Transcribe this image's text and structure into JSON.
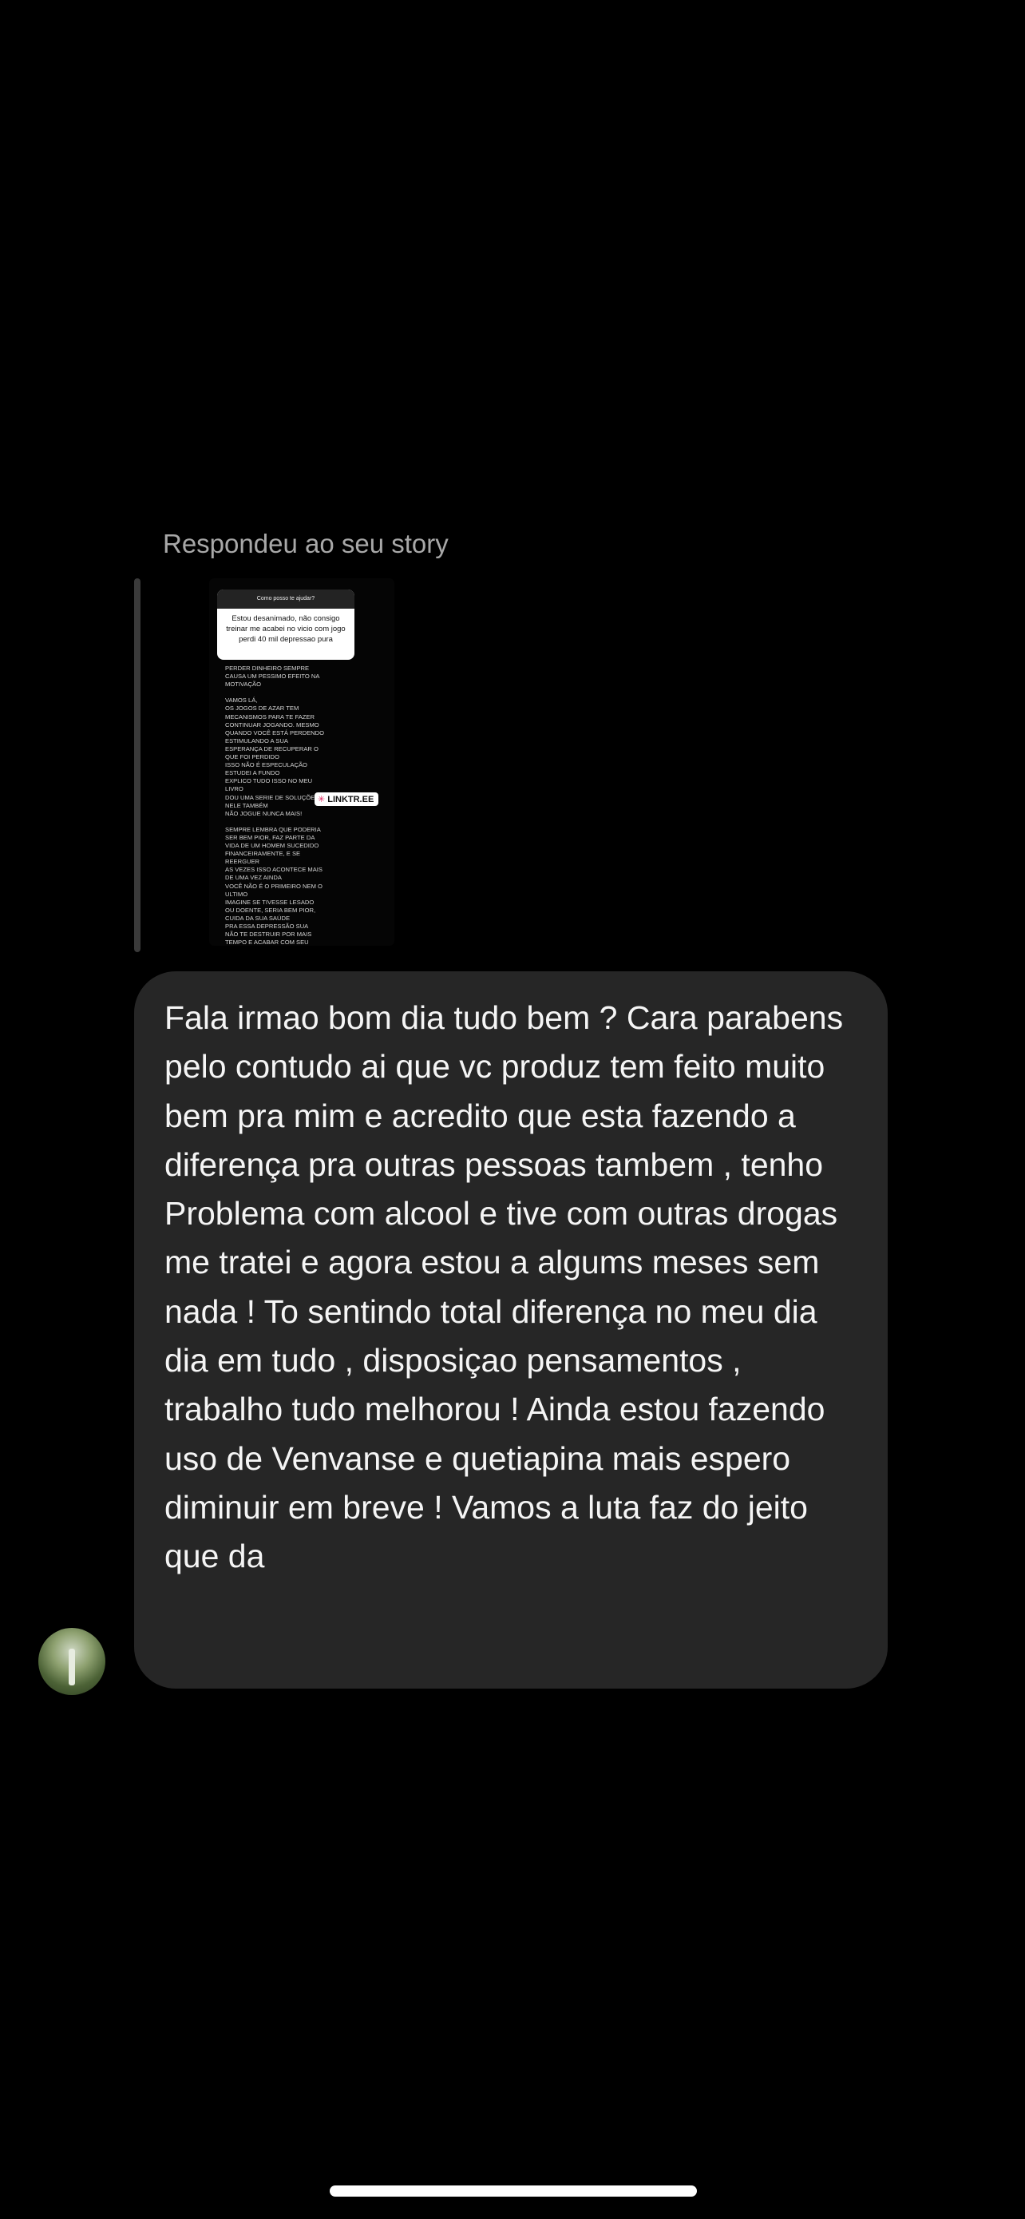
{
  "conversation": {
    "reply_context_label": "Respondeu ao seu story"
  },
  "story": {
    "question_header": "Como posso te ajudar?",
    "question_text": "Estou desanimado, não consigo treinar me acabei no vicio com jogo perdi 40 mil depressao pura",
    "body_text": "PERDER DINHEIRO SEMPRE\nCAUSA UM PESSIMO EFEITO NA\nMOTIVAÇÃO\n\nVAMOS LÁ,\nOS JOGOS DE AZAR TEM\nMECANISMOS PARA TE FAZER\nCONTINUAR JOGANDO. MESMO\nQUANDO VOCÊ ESTÁ PERDENDO\nESTIMULANDO A SUA\nESPERANÇA DE RECUPERAR O\nQUE FOI PERDIDO\nISSO NÃO É ESPECULAÇÃO\nESTUDEI A FUNDO\nEXPLICO TUDO ISSO NO MEU\nLIVRO\nDOU UMA SERIE DE SOLUÇÕES\nNELE TAMBÉM\nNÃO JOGUE NUNCA MAIS!\n\nSEMPRE LEMBRA QUE PODERIA\nSER BEM PIOR, FAZ PARTE DA\nVIDA DE UM HOMEM SUCEDIDO\nFINANCEIRAMENTE, E SE\nREERGUER\nAS VEZES ISSO ACONTECE MAIS\nDE UMA VEZ AINDA\nVOCÊ NÃO É O PRIMEIRO NEM O\nULTIMO\nIMAGINE SE TIVESSE LESADO\nOU DOENTE, SERIA BEM PIOR,\nCUIDA DA SUA SAÚDE\nPRA ESSA DEPRESSÃO SUA\nNÃO TE DESTRUIR POR MAIS\nTEMPO E ACABAR COM SEU\nBEM MAIS PRECIOSO\nSUA SAÚDE",
    "sticker_label": "LINKTR.EE"
  },
  "message": {
    "text": "Fala irmao bom dia tudo bem ? Cara parabens pelo contudo ai que vc produz tem feito muito bem pra mim e acredito que esta fazendo a diferença pra outras pessoas tambem , tenho Problema com alcool e tive com outras drogas me tratei e agora estou a algums meses sem nada ! To sentindo total diferença no meu dia dia em tudo , disposiçao pensamentos , trabalho tudo melhorou ! Ainda estou fazendo uso de Venvanse e quetiapina mais espero diminuir em breve ! Vamos a luta faz do jeito que da"
  },
  "icons": {
    "linktree": "link-icon",
    "avatar": "sender-avatar"
  },
  "colors": {
    "background": "#000000",
    "bubble": "#262626",
    "secondary_text": "#a8a8a8"
  }
}
